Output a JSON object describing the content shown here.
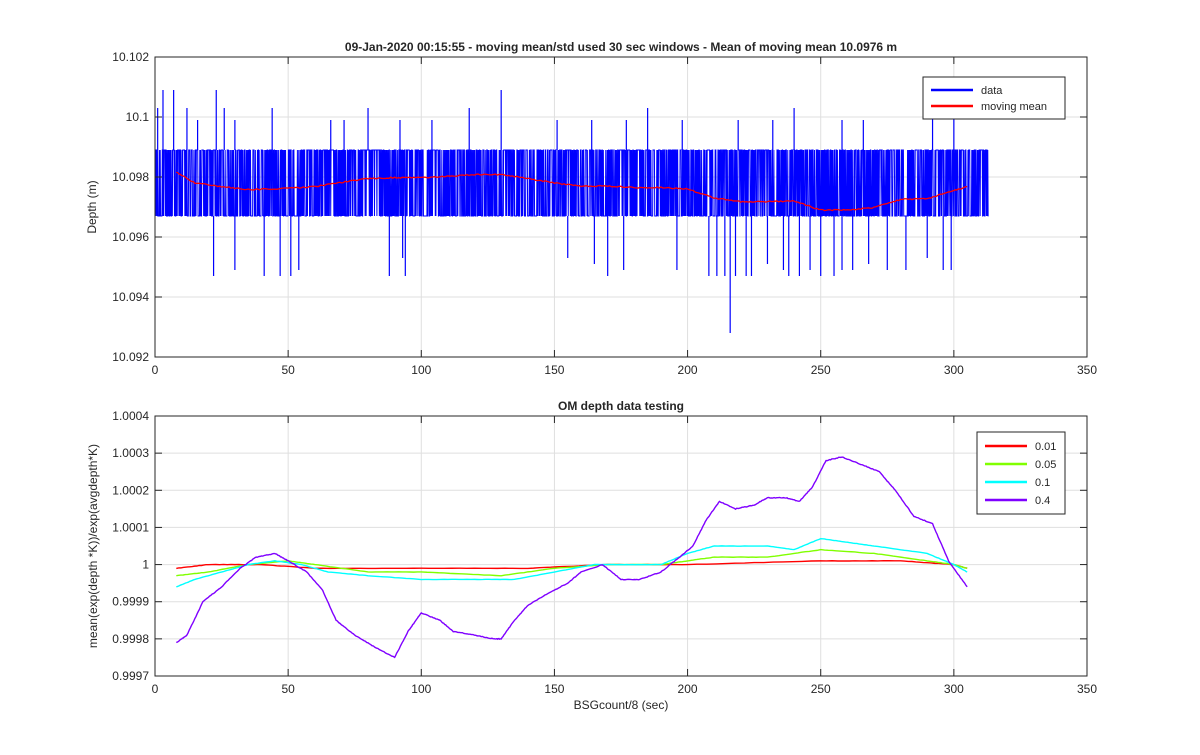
{
  "chart_data": [
    {
      "type": "line",
      "title": "09-Jan-2020 00:15:55 - moving mean/std used 30 sec windows - Mean of moving mean 10.0976 m",
      "xlabel": "",
      "ylabel": "Depth (m)",
      "xlim": [
        0,
        350
      ],
      "ylim": [
        10.092,
        10.102
      ],
      "xticks": [
        "0",
        "50",
        "100",
        "150",
        "200",
        "250",
        "300",
        "350"
      ],
      "yticks": [
        "10.092",
        "10.094",
        "10.096",
        "10.098",
        "10.1",
        "10.102"
      ],
      "grid": true,
      "legend_position": "top-right",
      "series": [
        {
          "name": "data",
          "color": "#0000ff",
          "style": "dense noisy signal oscillating between levels",
          "levels": [
            10.0967,
            10.0989
          ],
          "x_range": [
            0,
            313
          ],
          "spikes_up": [
            {
              "x": 1,
              "y": 10.1003
            },
            {
              "x": 3,
              "y": 10.1009
            },
            {
              "x": 7,
              "y": 10.1009
            },
            {
              "x": 12,
              "y": 10.1003
            },
            {
              "x": 16,
              "y": 10.0999
            },
            {
              "x": 23,
              "y": 10.1009
            },
            {
              "x": 26,
              "y": 10.1003
            },
            {
              "x": 30,
              "y": 10.0999
            },
            {
              "x": 44,
              "y": 10.1003
            },
            {
              "x": 66,
              "y": 10.0999
            },
            {
              "x": 71,
              "y": 10.0999
            },
            {
              "x": 80,
              "y": 10.1003
            },
            {
              "x": 92,
              "y": 10.0999
            },
            {
              "x": 104,
              "y": 10.0999
            },
            {
              "x": 118,
              "y": 10.1003
            },
            {
              "x": 130,
              "y": 10.1009
            },
            {
              "x": 151,
              "y": 10.0999
            },
            {
              "x": 164,
              "y": 10.0999
            },
            {
              "x": 177,
              "y": 10.0999
            },
            {
              "x": 185,
              "y": 10.1003
            },
            {
              "x": 198,
              "y": 10.0999
            },
            {
              "x": 219,
              "y": 10.0999
            },
            {
              "x": 232,
              "y": 10.0999
            },
            {
              "x": 240,
              "y": 10.1003
            },
            {
              "x": 258,
              "y": 10.0999
            },
            {
              "x": 266,
              "y": 10.0999
            },
            {
              "x": 292,
              "y": 10.1003
            },
            {
              "x": 300,
              "y": 10.1003
            }
          ],
          "spikes_down": [
            {
              "x": 22,
              "y": 10.0947
            },
            {
              "x": 30,
              "y": 10.0949
            },
            {
              "x": 41,
              "y": 10.0947
            },
            {
              "x": 47,
              "y": 10.0947
            },
            {
              "x": 51,
              "y": 10.0947
            },
            {
              "x": 54,
              "y": 10.0949
            },
            {
              "x": 88,
              "y": 10.0947
            },
            {
              "x": 93,
              "y": 10.0953
            },
            {
              "x": 94,
              "y": 10.0947
            },
            {
              "x": 155,
              "y": 10.0953
            },
            {
              "x": 165,
              "y": 10.0951
            },
            {
              "x": 170,
              "y": 10.0947
            },
            {
              "x": 176,
              "y": 10.0949
            },
            {
              "x": 196,
              "y": 10.0949
            },
            {
              "x": 208,
              "y": 10.0947
            },
            {
              "x": 211,
              "y": 10.0947
            },
            {
              "x": 214,
              "y": 10.0947
            },
            {
              "x": 216,
              "y": 10.0928
            },
            {
              "x": 218,
              "y": 10.0947
            },
            {
              "x": 222,
              "y": 10.0947
            },
            {
              "x": 224,
              "y": 10.0947
            },
            {
              "x": 230,
              "y": 10.0951
            },
            {
              "x": 236,
              "y": 10.0949
            },
            {
              "x": 238,
              "y": 10.0947
            },
            {
              "x": 242,
              "y": 10.0947
            },
            {
              "x": 246,
              "y": 10.0949
            },
            {
              "x": 250,
              "y": 10.0947
            },
            {
              "x": 255,
              "y": 10.0947
            },
            {
              "x": 258,
              "y": 10.0949
            },
            {
              "x": 262,
              "y": 10.0949
            },
            {
              "x": 268,
              "y": 10.0951
            },
            {
              "x": 275,
              "y": 10.0949
            },
            {
              "x": 282,
              "y": 10.0949
            },
            {
              "x": 290,
              "y": 10.0953
            },
            {
              "x": 296,
              "y": 10.0949
            },
            {
              "x": 299,
              "y": 10.0949
            }
          ]
        },
        {
          "name": "moving mean",
          "color": "#ff0000",
          "x": [
            8,
            15,
            25,
            35,
            50,
            60,
            70,
            80,
            90,
            100,
            110,
            120,
            130,
            140,
            150,
            160,
            170,
            180,
            190,
            200,
            210,
            220,
            230,
            240,
            250,
            260,
            270,
            280,
            290,
            300,
            305
          ],
          "y": [
            10.09815,
            10.0978,
            10.09768,
            10.09758,
            10.09762,
            10.09768,
            10.09782,
            10.09795,
            10.09798,
            10.09798,
            10.09802,
            10.09808,
            10.09808,
            10.09795,
            10.0978,
            10.0977,
            10.0977,
            10.09765,
            10.09765,
            10.0976,
            10.0973,
            10.09718,
            10.09718,
            10.0972,
            10.0969,
            10.0969,
            10.09698,
            10.09725,
            10.09728,
            10.09755,
            10.09768
          ]
        }
      ]
    },
    {
      "type": "line",
      "title": "OM depth data testing",
      "xlabel": "BSGcount/8 (sec)",
      "ylabel": "mean(exp(depth *K))/exp(avgdepth*K)",
      "xlim": [
        0,
        350
      ],
      "ylim": [
        0.9997,
        1.0004
      ],
      "xticks": [
        "0",
        "50",
        "100",
        "150",
        "200",
        "250",
        "300",
        "350"
      ],
      "yticks": [
        "0.9997",
        "0.9998",
        "0.9999",
        "1",
        "1.0001",
        "1.0002",
        "1.0003",
        "1.0004"
      ],
      "grid": true,
      "legend_position": "top-right",
      "series": [
        {
          "name": "0.01",
          "color": "#ff0000",
          "x": [
            8,
            20,
            40,
            60,
            100,
            140,
            170,
            200,
            250,
            280,
            300,
            305
          ],
          "y": [
            0.99999,
            1.0,
            1.0,
            0.99999,
            0.99999,
            0.99999,
            1.0,
            1.0,
            1.00001,
            1.00001,
            1.0,
            0.99999
          ]
        },
        {
          "name": "0.05",
          "color": "#80ff00",
          "x": [
            8,
            20,
            35,
            50,
            60,
            80,
            100,
            130,
            150,
            170,
            190,
            200,
            210,
            230,
            250,
            270,
            290,
            300,
            305
          ],
          "y": [
            0.99997,
            0.99998,
            1.0,
            1.00001,
            1.0,
            0.99998,
            0.99998,
            0.99997,
            0.99999,
            1.0,
            1.0,
            1.00001,
            1.00002,
            1.00002,
            1.00004,
            1.00003,
            1.00001,
            1.0,
            0.99999
          ]
        },
        {
          "name": "0.1",
          "color": "#00ffff",
          "x": [
            8,
            15,
            25,
            35,
            45,
            55,
            65,
            80,
            100,
            120,
            135,
            150,
            165,
            175,
            190,
            200,
            210,
            230,
            240,
            250,
            260,
            270,
            290,
            300,
            305
          ],
          "y": [
            0.99994,
            0.99996,
            0.99998,
            1.0,
            1.00001,
            1.0,
            0.99998,
            0.99997,
            0.99996,
            0.99996,
            0.99996,
            0.99998,
            1.0,
            1.0,
            1.0,
            1.00003,
            1.00005,
            1.00005,
            1.00004,
            1.00007,
            1.00006,
            1.00005,
            1.00003,
            1.0,
            0.99998
          ]
        },
        {
          "name": "0.4",
          "color": "#7f00ff",
          "x": [
            8,
            12,
            18,
            25,
            32,
            38,
            45,
            50,
            57,
            63,
            68,
            75,
            82,
            90,
            95,
            100,
            107,
            112,
            120,
            127,
            130,
            135,
            140,
            147,
            155,
            160,
            168,
            175,
            182,
            190,
            197,
            202,
            207,
            212,
            218,
            225,
            230,
            237,
            242,
            247,
            252,
            258,
            265,
            272,
            278,
            285,
            292,
            298,
            305
          ],
          "y": [
            0.99979,
            0.99981,
            0.9999,
            0.99994,
            0.99999,
            1.00002,
            1.00003,
            1.00001,
            0.99998,
            0.99993,
            0.99985,
            0.99981,
            0.99978,
            0.99975,
            0.99982,
            0.99987,
            0.99985,
            0.99982,
            0.99981,
            0.9998,
            0.9998,
            0.99985,
            0.99989,
            0.99992,
            0.99995,
            0.99998,
            1.0,
            0.99996,
            0.99996,
            0.99998,
            1.00002,
            1.00005,
            1.00012,
            1.00017,
            1.00015,
            1.00016,
            1.00018,
            1.00018,
            1.00017,
            1.00021,
            1.00028,
            1.00029,
            1.00027,
            1.00025,
            1.0002,
            1.00013,
            1.00011,
            1.00001,
            0.99994
          ]
        }
      ]
    }
  ]
}
